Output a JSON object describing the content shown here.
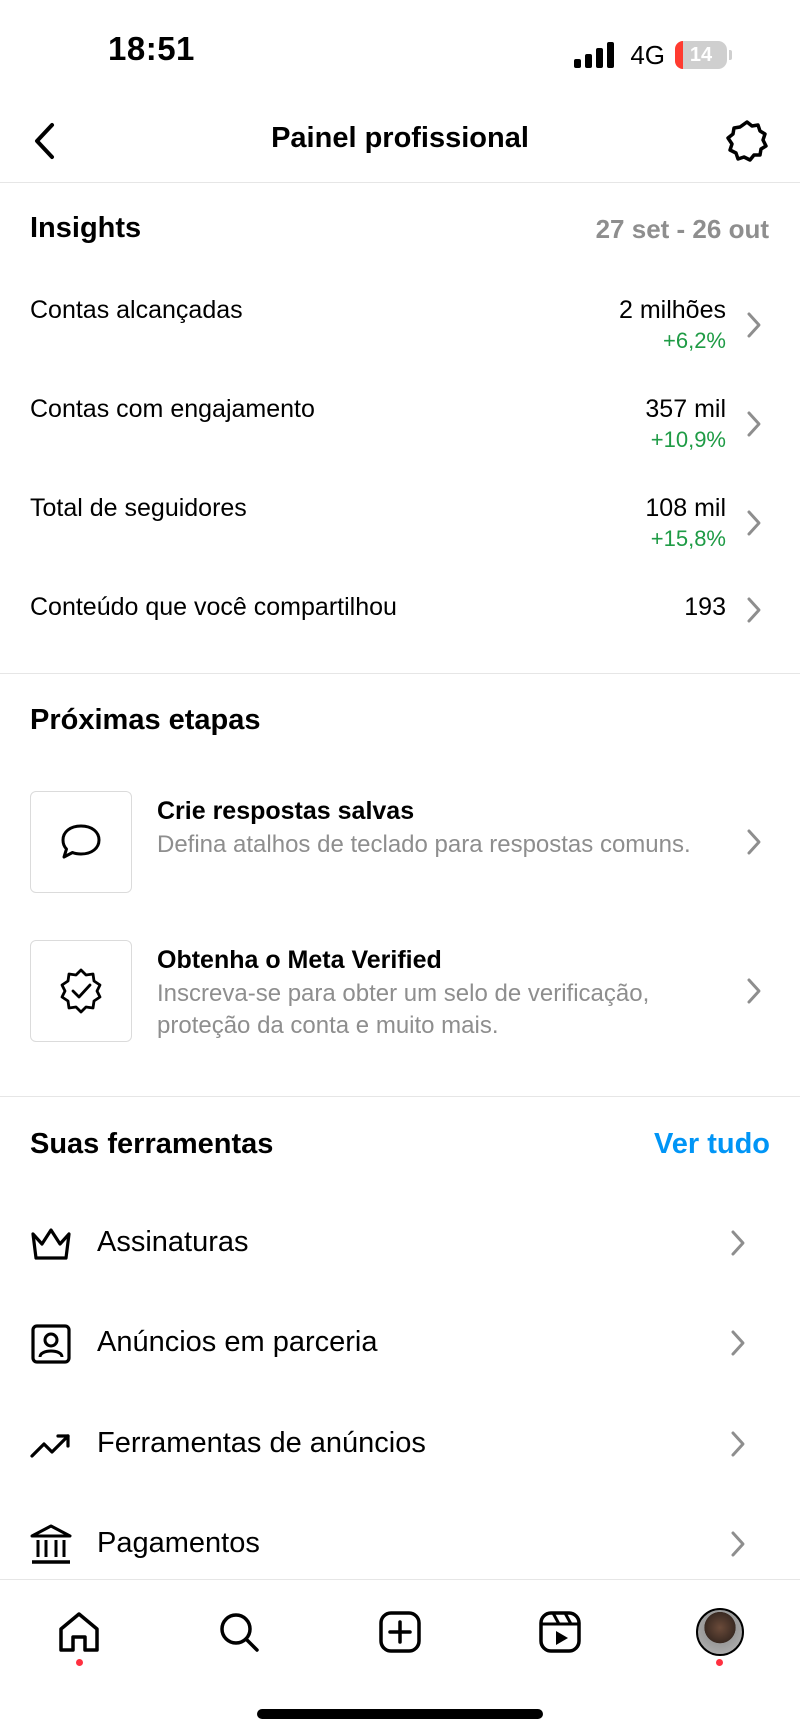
{
  "status_bar": {
    "time": "18:51",
    "network": "4G",
    "battery_level": "14",
    "battery_color": "#ff3b30"
  },
  "header": {
    "title": "Painel profissional",
    "back_icon": "chevron-left-icon",
    "settings_icon": "gear-icon"
  },
  "insights": {
    "title": "Insights",
    "date_range": "27 set - 26 out",
    "metrics": [
      {
        "label": "Contas alcançadas",
        "value": "2 milhões",
        "change": "+6,2%"
      },
      {
        "label": "Contas com engajamento",
        "value": "357 mil",
        "change": "+10,9%"
      },
      {
        "label": "Total de seguidores",
        "value": "108 mil",
        "change": "+15,8%"
      },
      {
        "label": "Conteúdo que você compartilhou",
        "value": "193",
        "change": ""
      }
    ],
    "change_color": "#1e9b45"
  },
  "next_steps": {
    "title": "Próximas etapas",
    "items": [
      {
        "icon": "chat-bubble-icon",
        "title": "Crie respostas salvas",
        "description": "Defina atalhos de teclado para respostas comuns."
      },
      {
        "icon": "verified-badge-icon",
        "title": "Obtenha o Meta Verified",
        "description": "Inscreva-se para obter um selo de verificação, proteção da conta e muito mais."
      }
    ]
  },
  "tools": {
    "title": "Suas ferramentas",
    "see_all": "Ver tudo",
    "accent_color": "#0095f6",
    "items": [
      {
        "icon": "crown-icon",
        "label": "Assinaturas"
      },
      {
        "icon": "partner-ads-icon",
        "label": "Anúncios em parceria"
      },
      {
        "icon": "trending-up-icon",
        "label": "Ferramentas de anúncios"
      },
      {
        "icon": "bank-icon",
        "label": "Pagamentos"
      }
    ]
  },
  "tab_bar": {
    "items": [
      {
        "icon": "home-icon"
      },
      {
        "icon": "search-icon"
      },
      {
        "icon": "create-icon"
      },
      {
        "icon": "reels-icon"
      },
      {
        "icon": "profile-avatar"
      }
    ]
  }
}
